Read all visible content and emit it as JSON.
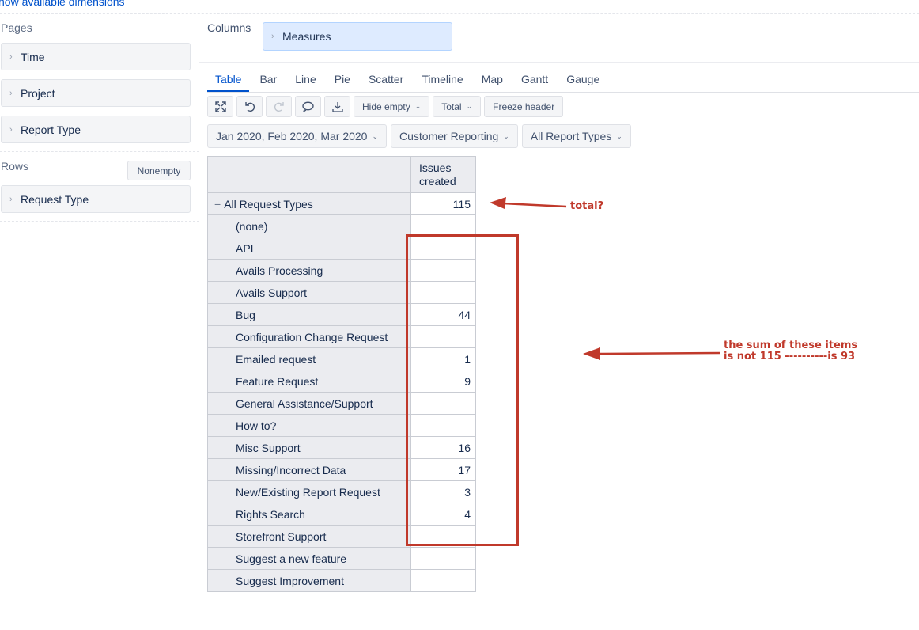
{
  "top_link": "how available dimensions",
  "left_pane": {
    "pages_title": "Pages",
    "pages": [
      {
        "label": "Time"
      },
      {
        "label": "Project"
      },
      {
        "label": "Report Type"
      }
    ],
    "rows_title": "Rows",
    "nonempty_label": "Nonempty",
    "rows": [
      {
        "label": "Request Type"
      }
    ]
  },
  "columns": {
    "title": "Columns",
    "measures_label": "Measures"
  },
  "tabs": [
    {
      "label": "Table",
      "active": true
    },
    {
      "label": "Bar"
    },
    {
      "label": "Line"
    },
    {
      "label": "Pie"
    },
    {
      "label": "Scatter"
    },
    {
      "label": "Timeline"
    },
    {
      "label": "Map"
    },
    {
      "label": "Gantt"
    },
    {
      "label": "Gauge"
    }
  ],
  "toolbar": {
    "icons": {
      "fullscreen": "expand-icon",
      "undo": "undo-icon",
      "redo": "redo-icon",
      "comment": "comment-icon",
      "export": "export-icon"
    },
    "hide_empty_label": "Hide empty",
    "total_label": "Total",
    "freeze_header_label": "Freeze header"
  },
  "filters": {
    "time": "Jan 2020, Feb 2020, Mar 2020",
    "project": "Customer Reporting",
    "report_type": "All Report Types"
  },
  "table": {
    "column_header": [
      "Issues",
      "created"
    ],
    "total_row": {
      "label": "All Request Types",
      "value": "115"
    },
    "rows": [
      {
        "label": "(none)",
        "value": ""
      },
      {
        "label": "API",
        "value": ""
      },
      {
        "label": "Avails Processing",
        "value": ""
      },
      {
        "label": "Avails Support",
        "value": ""
      },
      {
        "label": "Bug",
        "value": "44"
      },
      {
        "label": "Configuration Change Request",
        "value": ""
      },
      {
        "label": "Emailed request",
        "value": "1"
      },
      {
        "label": "Feature Request",
        "value": "9"
      },
      {
        "label": "General Assistance/Support",
        "value": ""
      },
      {
        "label": "How to?",
        "value": ""
      },
      {
        "label": "Misc Support",
        "value": "16"
      },
      {
        "label": "Missing/Incorrect Data",
        "value": "17"
      },
      {
        "label": "New/Existing Report Request",
        "value": "3"
      },
      {
        "label": "Rights Search",
        "value": "4"
      },
      {
        "label": "Storefront Support",
        "value": ""
      },
      {
        "label": "Suggest a new feature",
        "value": ""
      },
      {
        "label": "Suggest Improvement",
        "value": ""
      }
    ]
  },
  "annotations": {
    "total_note": "total?",
    "sum_note_line1": "the sum of these items",
    "sum_note_line2": "is not 115 ----------is 93",
    "color": "#c0392b"
  }
}
